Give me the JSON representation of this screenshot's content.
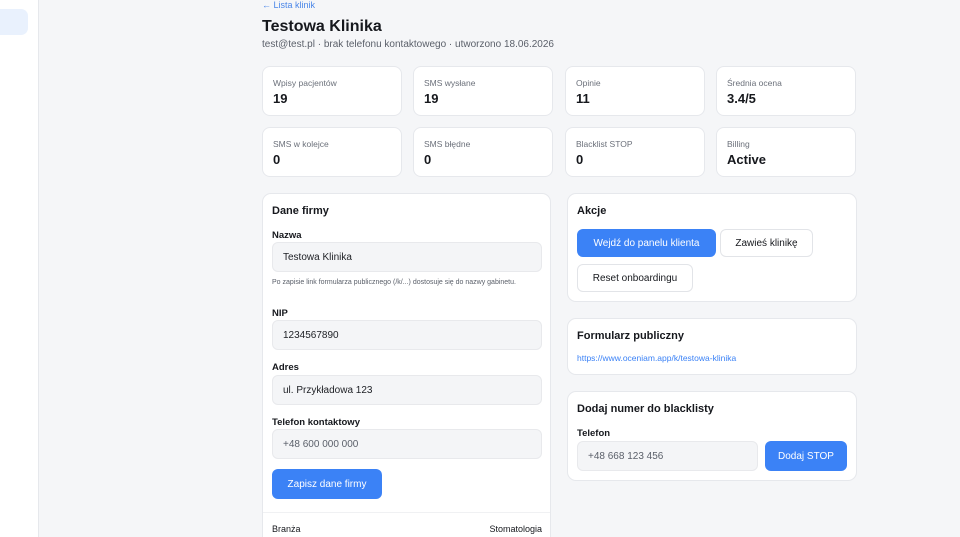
{
  "back_link": "← Lista klinik",
  "clinic": {
    "name": "Testowa Klinika",
    "subtitle": "test@test.pl · brak telefonu kontaktowego · utworzono 18.06.2026"
  },
  "stats": [
    {
      "label": "Wpisy pacjentów",
      "value": "19"
    },
    {
      "label": "SMS wysłane",
      "value": "19"
    },
    {
      "label": "Opinie",
      "value": "11"
    },
    {
      "label": "Średnia ocena",
      "value": "3.4/5"
    },
    {
      "label": "SMS w kolejce",
      "value": "0"
    },
    {
      "label": "SMS błędne",
      "value": "0"
    },
    {
      "label": "Blacklist STOP",
      "value": "0"
    },
    {
      "label": "Billing",
      "value": "Active"
    }
  ],
  "company": {
    "title": "Dane firmy",
    "name_label": "Nazwa",
    "name_value": "Testowa Klinika",
    "name_hint": "Po zapisie link formularza publicznego (/k/...) dostosuje się do nazwy gabinetu.",
    "nip_label": "NIP",
    "nip_value": "1234567890",
    "address_label": "Adres",
    "address_value": "ul. Przykładowa 123",
    "phone_label": "Telefon kontaktowy",
    "phone_placeholder": "+48 600 000 000",
    "save_label": "Zapisz dane firmy",
    "industry_label": "Branża",
    "industry_value": "Stomatologia"
  },
  "actions": {
    "title": "Akcje",
    "enter_panel": "Wejdź do panelu klienta",
    "suspend": "Zawieś klinikę",
    "reset": "Reset onboardingu"
  },
  "public_form": {
    "title": "Formularz publiczny",
    "url": "https://www.oceniam.app/k/testowa-klinika"
  },
  "blacklist": {
    "title": "Dodaj numer do blacklisty",
    "phone_label": "Telefon",
    "phone_placeholder": "+48 668 123 456",
    "add_label": "Dodaj STOP"
  },
  "colors": {
    "accent": "#3b82f6",
    "background": "#f5f6f8",
    "card": "#ffffff"
  }
}
